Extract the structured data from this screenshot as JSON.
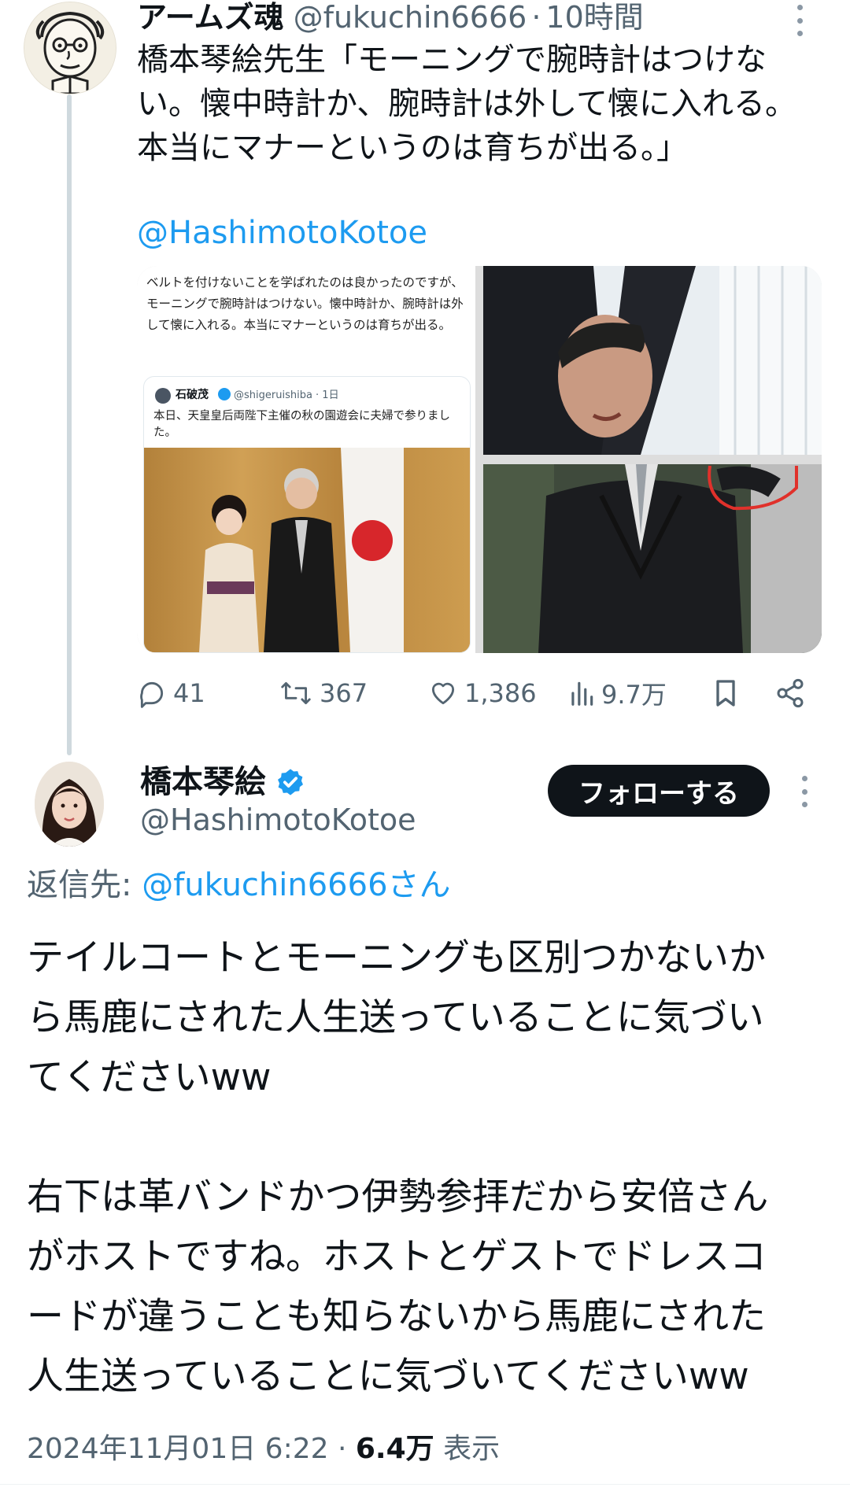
{
  "parent_tweet": {
    "author_name": "アームズ魂",
    "handle": "@fukuchin6666",
    "separator": "·",
    "time": "10時間",
    "text_lines": [
      "橋本琴絵先生「モーニングで腕時計はつけな",
      "い。懐中時計か、腕時計は外して懐に入れる。",
      "本当にマナーというのは育ちが出る。」"
    ],
    "mention": "@HashimotoKotoe",
    "media": {
      "screenshot_text": "ベルトを付けないことを学ばれたのは良かったのですが、モーニングで腕時計はつけない。懐中時計か、腕時計は外して懐に入れる。本当にマナーというのは育ちが出る。",
      "quoted": {
        "name": "石破茂",
        "handle_time": "@shigeruishiba · 1日",
        "text": "本日、天皇皇后両陛下主催の秋の園遊会に夫婦で参りました。"
      }
    },
    "actions": {
      "replies": "41",
      "retweets": "367",
      "likes": "1,386",
      "views": "9.7万"
    }
  },
  "reply_tweet": {
    "author_name": "橋本琴絵",
    "handle": "@HashimotoKotoe",
    "follow_label": "フォローする",
    "reply_to_prefix": "返信先: ",
    "reply_to_user": "@fukuchin6666さん",
    "body_lines": [
      "テイルコートとモーニングも区別つかないか",
      "ら馬鹿にされた人生送っていることに気づい",
      "てくださいww",
      "",
      "右下は革バンドかつ伊勢参拝だから安倍さん",
      "がホストですね。ホストとゲストでドレスコ",
      "ードが違うことも知らないから馬鹿にされた",
      "人生送っていることに気づいてくださいww"
    ],
    "timestamp": "2024年11月01日 6:22",
    "separator": " · ",
    "view_count": "6.4万",
    "view_label": " 表示"
  },
  "colors": {
    "accent": "#1d9bf0",
    "text": "#0f1419",
    "muted": "#536471",
    "thread_line": "#cfd9de",
    "follow_bg": "#0f1419",
    "annotation_red": "#e0312b"
  },
  "icons": [
    "reply-icon",
    "retweet-icon",
    "like-icon",
    "views-icon",
    "bookmark-icon",
    "share-icon",
    "verified-badge-icon",
    "more-options-icon"
  ]
}
